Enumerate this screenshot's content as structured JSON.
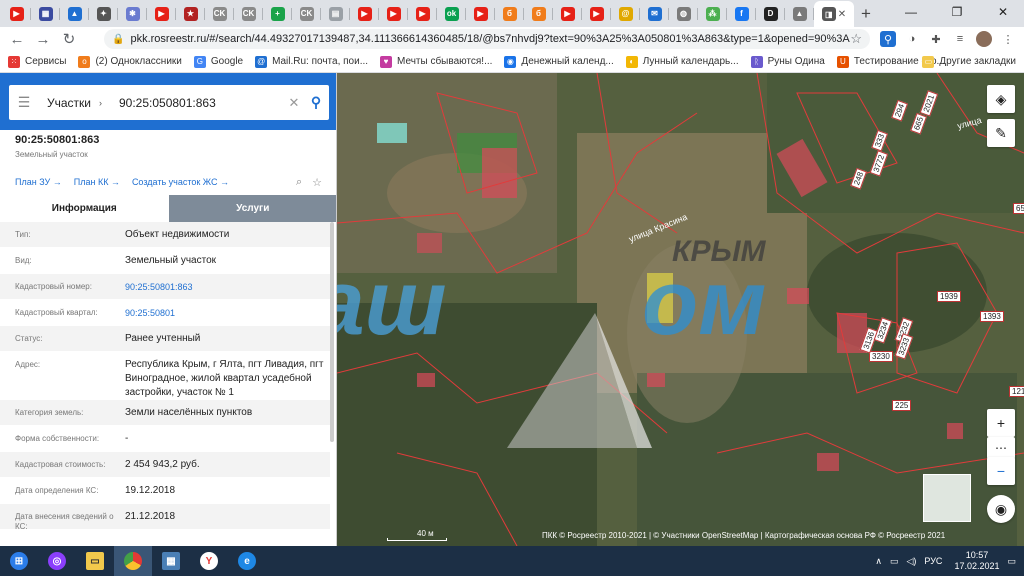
{
  "browser": {
    "tabs": [
      {
        "icon": "youtube-icon",
        "color": "#e62117",
        "glyph": "▶"
      },
      {
        "icon": "gallery-icon",
        "color": "#3b4ba0",
        "glyph": "▦"
      },
      {
        "icon": "triangle-icon",
        "color": "#1f6fd1",
        "glyph": "▲"
      },
      {
        "icon": "figure-icon",
        "color": "#555555",
        "glyph": "✦"
      },
      {
        "icon": "gear-icon",
        "color": "#6a7bd0",
        "glyph": "✱"
      },
      {
        "icon": "youtube-icon",
        "color": "#e62117",
        "glyph": "▶"
      },
      {
        "icon": "star-icon",
        "color": "#b22222",
        "glyph": "★"
      },
      {
        "icon": "ck-icon",
        "color": "#8a8a8a",
        "glyph": "CK"
      },
      {
        "icon": "ck-icon",
        "color": "#8a8a8a",
        "glyph": "CK"
      },
      {
        "icon": "plus-green-icon",
        "color": "#1aa34a",
        "glyph": "+"
      },
      {
        "icon": "ck-icon",
        "color": "#8a8a8a",
        "glyph": "CK"
      },
      {
        "icon": "doc-icon",
        "color": "#9aa0a6",
        "glyph": "▤"
      },
      {
        "icon": "youtube-icon",
        "color": "#e62117",
        "glyph": "▶"
      },
      {
        "icon": "youtube-icon",
        "color": "#e62117",
        "glyph": "▶"
      },
      {
        "icon": "youtube-icon",
        "color": "#e62117",
        "glyph": "▶"
      },
      {
        "icon": "ok-icon",
        "color": "#0aa050",
        "glyph": "ok"
      },
      {
        "icon": "youtube-icon",
        "color": "#e62117",
        "glyph": "▶"
      },
      {
        "icon": "b-orange-icon",
        "color": "#f07c1b",
        "glyph": "б"
      },
      {
        "icon": "b-orange-icon",
        "color": "#f07c1b",
        "glyph": "б"
      },
      {
        "icon": "youtube-icon",
        "color": "#e62117",
        "glyph": "▶"
      },
      {
        "icon": "youtube-icon",
        "color": "#e62117",
        "glyph": "▶"
      },
      {
        "icon": "mail-at-icon",
        "color": "#e0a800",
        "glyph": "@"
      },
      {
        "icon": "mail-icon",
        "color": "#1f6fd1",
        "glyph": "✉"
      },
      {
        "icon": "globe-icon",
        "color": "#7a7a7a",
        "glyph": "◍"
      },
      {
        "icon": "apps-icon",
        "color": "#4caf50",
        "glyph": "⁂"
      },
      {
        "icon": "facebook-icon",
        "color": "#1877f2",
        "glyph": "f"
      },
      {
        "icon": "d-icon",
        "color": "#222222",
        "glyph": "D"
      },
      {
        "icon": "map-icon",
        "color": "#7a7a7a",
        "glyph": "▲"
      }
    ],
    "active_tab": {
      "icon": "rosreestr-icon",
      "glyph": "◨",
      "close": "✕"
    },
    "new_tab": "+",
    "win": {
      "min": "—",
      "max": "❐",
      "close": "✕"
    },
    "url": "pkk.rosreestr.ru/#/search/44.49327017139487,34.111366614360485/18/@bs7nhvdj9?text=90%3A25%3A050801%3A863&type=1&opened=90%3A25%...",
    "back": "←",
    "forward": "→",
    "reload": "↻",
    "star": "☆",
    "bookmarks": [
      {
        "icon": "apps-grid-icon",
        "color": "#e53935",
        "glyph": "⁙",
        "label": "Сервисы"
      },
      {
        "icon": "ok-icon",
        "color": "#f07c1b",
        "glyph": "о",
        "label": "(2) Одноклассники"
      },
      {
        "icon": "google-icon",
        "color": "#4285f4",
        "glyph": "G",
        "label": "Google"
      },
      {
        "icon": "mailru-icon",
        "color": "#1f6fd1",
        "glyph": "@",
        "label": "Mail.Ru: почта, пои..."
      },
      {
        "icon": "heart-icon",
        "color": "#c43ba0",
        "glyph": "♥",
        "label": "Мечты сбываются!..."
      },
      {
        "icon": "coin-icon",
        "color": "#1a73e8",
        "glyph": "◉",
        "label": "Денежный календ..."
      },
      {
        "icon": "moon-icon",
        "color": "#f2b705",
        "glyph": "◐",
        "label": "Лунный календарь..."
      },
      {
        "icon": "rune-icon",
        "color": "#6a5acd",
        "glyph": "ᚱ",
        "label": "Руны Одина"
      },
      {
        "icon": "test-icon",
        "color": "#e65100",
        "glyph": "U",
        "label": "Тестирование ско..."
      }
    ],
    "other_bookmarks": {
      "icon": "folder-icon",
      "color": "#f2c94c",
      "glyph": "▭",
      "label": "Другие закладки"
    }
  },
  "search": {
    "type": "Участки",
    "value": "90:25:050801:863",
    "clear": "✕",
    "go": "⚲"
  },
  "object": {
    "title": "90:25:50801:863",
    "subtitle": "Земельный участок",
    "links": [
      "План ЗУ →",
      "План КК →",
      "Создать участок ЖС →"
    ],
    "tabs": {
      "info": "Информация",
      "services": "Услуги"
    },
    "rows": [
      {
        "k": "Тип:",
        "v": "Объект недвижимости",
        "link": false
      },
      {
        "k": "Вид:",
        "v": "Земельный участок",
        "link": false
      },
      {
        "k": "Кадастровый номер:",
        "v": "90:25:50801:863",
        "link": true
      },
      {
        "k": "Кадастровый квартал:",
        "v": "90:25:50801",
        "link": true
      },
      {
        "k": "Статус:",
        "v": "Ранее учтенный",
        "link": false
      },
      {
        "k": "Адрес:",
        "v": "Республика Крым, г Ялта, пгт Ливадия, пгт Виноградное, жилой квартал усадебной застройки, участок № 1",
        "link": false
      },
      {
        "k": "Категория земель:",
        "v": "Земли населённых пунктов",
        "link": false
      },
      {
        "k": "Форма собственности:",
        "v": "-",
        "link": false
      },
      {
        "k": "Кадастровая стоимость:",
        "v": "2 454 943,2 руб.",
        "link": false
      },
      {
        "k": "Дата определения КС:",
        "v": "19.12.2018",
        "link": false
      },
      {
        "k": "Дата внесения сведений о КС:",
        "v": "21.12.2018",
        "link": false
      }
    ]
  },
  "map": {
    "streets": [
      "улица Красина",
      "улица"
    ],
    "plots": [
      "248",
      "3772",
      "333",
      "294",
      "2021",
      "665",
      "1939",
      "1393",
      "3230",
      "3232",
      "3233",
      "3136",
      "3234",
      "225",
      "121",
      "65"
    ],
    "watermark": {
      "left": "Ваш",
      "right": "ом",
      "brand": "КРЫМ"
    },
    "scale": "40 м",
    "attribution": "ПКК © Росреестр 2010-2021 | © Участники OpenStreetMap | Картографическая основа РФ © Росреестр 2021",
    "zoom_in": "+",
    "zoom_out": "−",
    "more": "⋯"
  },
  "taskbar": {
    "lang": "РУС",
    "time": "10:57",
    "date": "17.02.2021"
  }
}
